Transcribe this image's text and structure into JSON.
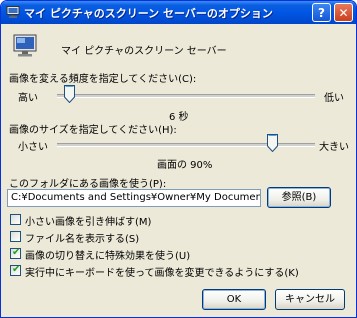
{
  "window": {
    "title": "マイ ピクチャのスクリーン セーバーのオプション"
  },
  "titlebar": {
    "help_label": "?",
    "close_label": "✕"
  },
  "header": {
    "name": "マイ ピクチャのスクリーン セーバー"
  },
  "frequency": {
    "label": "画像を変える頻度を指定してください(C):",
    "min_label": "高い",
    "max_label": "低い",
    "value_text": "6 秒",
    "level": 0.03
  },
  "size": {
    "label": "画像のサイズを指定してください(H):",
    "min_label": "小さい",
    "max_label": "大きい",
    "value_text": "画面の 90%",
    "level": 0.85
  },
  "folder": {
    "label": "このフォルダにある画像を使う(P):",
    "path": "C:¥Documents and Settings¥Owner¥My Documents¥My Pictur",
    "browse_label": "参照(B)"
  },
  "options": [
    {
      "label": "小さい画像を引き伸ばす(M)",
      "checked": false
    },
    {
      "label": "ファイル名を表示する(S)",
      "checked": false
    },
    {
      "label": "画像の切り替えに特殊効果を使う(U)",
      "checked": true
    },
    {
      "label": "実行中にキーボードを使って画像を変更できるようにする(K)",
      "checked": true
    }
  ],
  "buttons": {
    "ok": "OK",
    "cancel": "キャンセル"
  },
  "colors": {
    "titlebar": "#0054e3",
    "dialog_bg": "#ece9d8",
    "check": "#21a121"
  },
  "icons": {
    "title": "monitor-icon",
    "header": "monitor-icon"
  }
}
